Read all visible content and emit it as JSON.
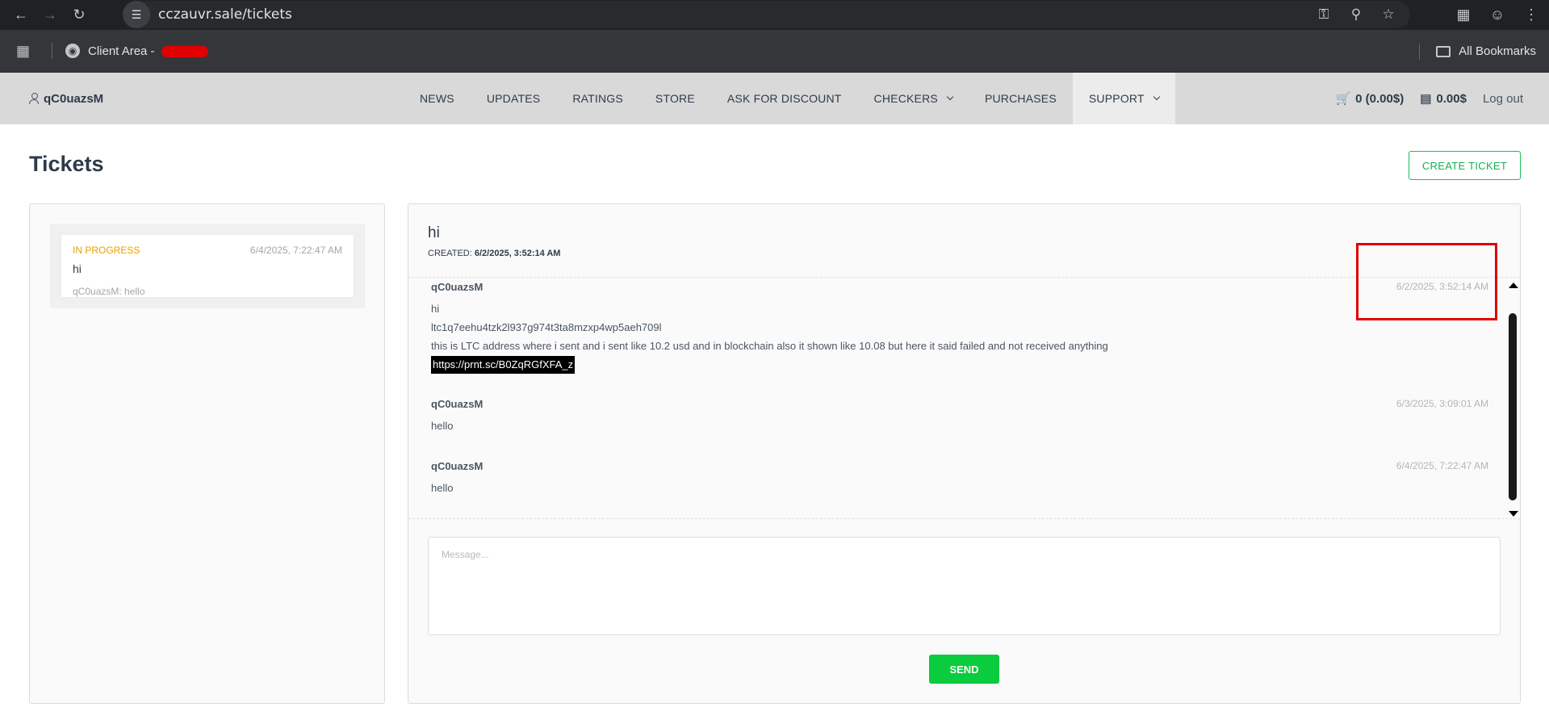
{
  "browser": {
    "url": "cczauvr.sale/tickets",
    "bookmark_label": "Client Area - ",
    "all_bookmarks": "All Bookmarks"
  },
  "header": {
    "username": "qC0uazsM",
    "menu": [
      {
        "label": "NEWS"
      },
      {
        "label": "UPDATES"
      },
      {
        "label": "RATINGS"
      },
      {
        "label": "STORE"
      },
      {
        "label": "ASK FOR DISCOUNT"
      },
      {
        "label": "CHECKERS"
      },
      {
        "label": "PURCHASES"
      },
      {
        "label": "SUPPORT"
      }
    ],
    "cart": "0 (0.00$)",
    "balance": "0.00$",
    "logout": "Log out"
  },
  "page": {
    "title": "Tickets",
    "create_button": "CREATE TICKET"
  },
  "ticket_list": [
    {
      "status": "IN PROGRESS",
      "date": "6/4/2025, 7:22:47 AM",
      "title": "hi",
      "preview": "qC0uazsM: hello"
    }
  ],
  "ticket": {
    "title": "hi",
    "created_label": "CREATED:",
    "created_value": "6/2/2025, 3:52:14 AM",
    "messages": [
      {
        "user": "qC0uazsM",
        "date": "6/2/2025, 3:52:14 AM",
        "lines": [
          "hi",
          "ltc1q7eehu4tzk2l937g974t3ta8mzxp4wp5aeh709l",
          "this is LTC address where i sent and i sent like 10.2 usd and in blockchain also it shown like 10.08 but here it said failed and not received anything"
        ],
        "link": "https://prnt.sc/B0ZqRGfXFA_z"
      },
      {
        "user": "qC0uazsM",
        "date": "6/3/2025, 3:09:01 AM",
        "lines": [
          "hello"
        ]
      },
      {
        "user": "qC0uazsM",
        "date": "6/4/2025, 7:22:47 AM",
        "lines": [
          "hello"
        ]
      }
    ],
    "input_placeholder": "Message...",
    "send_button": "SEND"
  },
  "colors": {
    "accent_green": "#0bcb3e",
    "status_in_progress": "#e8a100",
    "highlight_red": "#e00000"
  }
}
